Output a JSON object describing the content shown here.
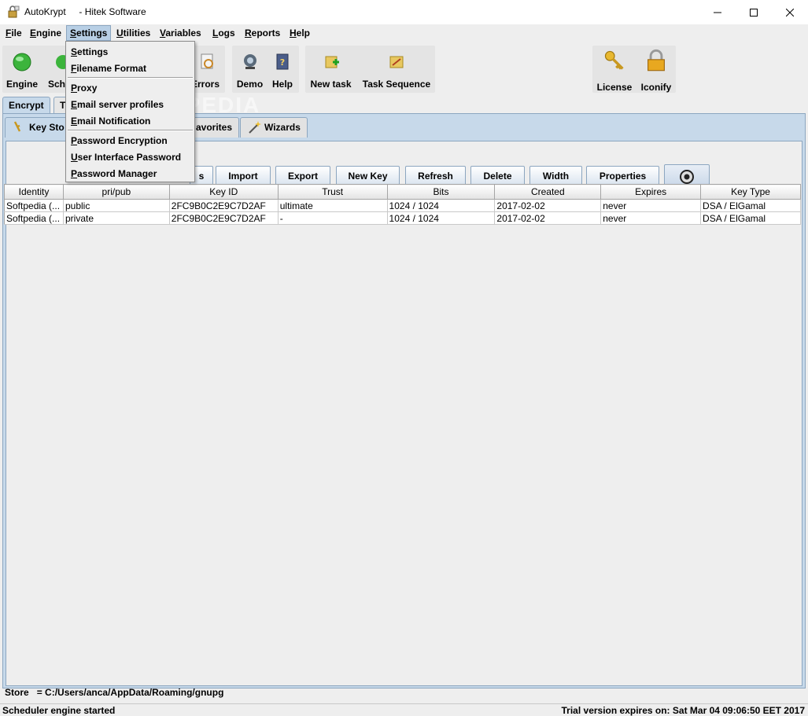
{
  "window": {
    "title": "AutoKrypt     - Hitek Software"
  },
  "menubar": [
    {
      "label": "File",
      "key": "F",
      "rest": "ile"
    },
    {
      "label": "Engine",
      "key": "E",
      "rest": "ngine"
    },
    {
      "label": "Settings",
      "key": "S",
      "rest": "ettings"
    },
    {
      "label": "Utilities",
      "key": "U",
      "rest": "tilities"
    },
    {
      "label": "Variables",
      "key": "V",
      "rest": "ariables"
    },
    {
      "label": "Logs",
      "key": "L",
      "rest": "ogs"
    },
    {
      "label": "Reports",
      "key": "R",
      "rest": "eports"
    },
    {
      "label": "Help",
      "key": "H",
      "rest": "elp"
    }
  ],
  "toolbar": {
    "engine": "Engine",
    "scheduler": "Sche",
    "errors": "Errors",
    "demo": "Demo",
    "help": "Help",
    "new_task": "New task",
    "task_sequence": "Task Sequence",
    "license": "License",
    "iconify": "Iconify"
  },
  "tabs": {
    "encrypt": "Encrypt",
    "second": "T"
  },
  "subtabs": {
    "key_store": "Key Sto",
    "favorites": "avorites",
    "wizards": "Wizards"
  },
  "buttons": {
    "partial": "s",
    "import": "Import",
    "export": "Export",
    "new_key": "New Key",
    "refresh": "Refresh",
    "delete": "Delete",
    "width": "Width",
    "properties": "Properties"
  },
  "table": {
    "headers": [
      "Identity",
      "pri/pub",
      "Key ID",
      "Trust",
      "Bits",
      "Created",
      "Expires",
      "Key Type"
    ],
    "rows": [
      [
        "Softpedia (...",
        "public",
        "2FC9B0C2E9C7D2AF",
        "ultimate",
        "1024 / 1024",
        "2017-02-02",
        "never",
        "DSA / ElGamal"
      ],
      [
        "Softpedia (...",
        "private",
        "2FC9B0C2E9C7D2AF",
        "-",
        "1024 / 1024",
        "2017-02-02",
        "never",
        "DSA / ElGamal"
      ]
    ]
  },
  "store": {
    "label": "Store",
    "value": "= C:/Users/anca/AppData/Roaming/gnupg"
  },
  "status": {
    "left": "Scheduler engine started",
    "right": "Trial version expires on: Sat Mar 04 09:06:50 EET 2017"
  },
  "dropdown": {
    "items": [
      {
        "label": "Settings",
        "key": "S",
        "rest": "ettings"
      },
      {
        "label": "Filename Format",
        "key": "F",
        "rest": "ilename Format"
      },
      {
        "label": "Proxy",
        "key": "P",
        "rest": "roxy"
      },
      {
        "label": "Email server profiles",
        "key": "E",
        "rest": "mail server profiles"
      },
      {
        "label": "Email Notification",
        "key": "E",
        "rest": "mail Notification"
      },
      {
        "label": "Password Encryption",
        "key": "P",
        "rest": "assword Encryption"
      },
      {
        "label": "User Interface Password",
        "key": "U",
        "rest": "ser Interface Password"
      },
      {
        "label": "Password Manager",
        "key": "P",
        "rest": "assword Manager"
      }
    ]
  },
  "watermark": "SOFTPEDIA"
}
